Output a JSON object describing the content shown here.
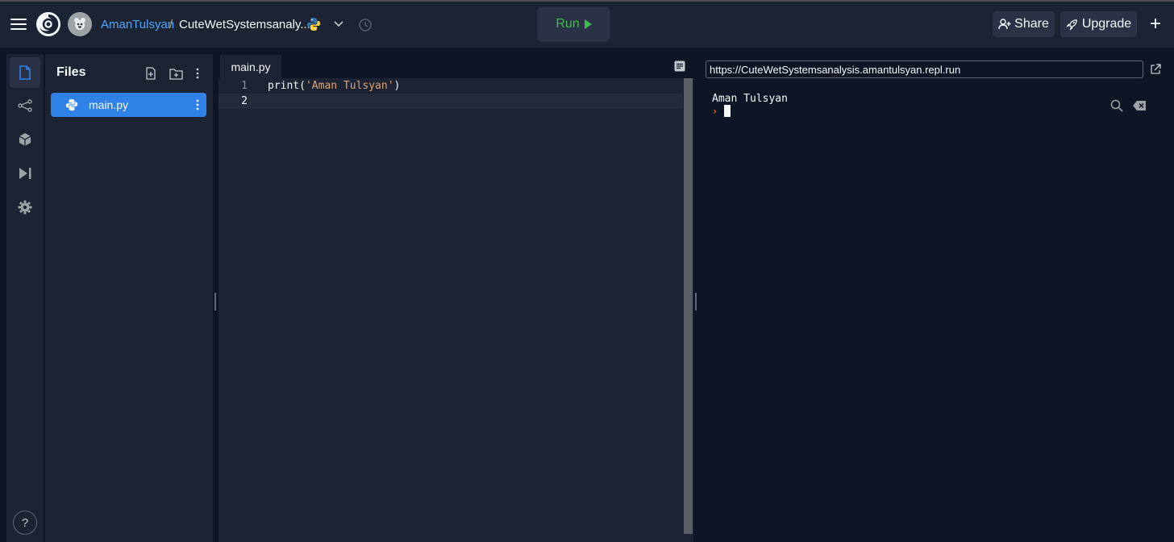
{
  "header": {
    "owner": "AmanTulsyan",
    "separator": "/",
    "repl_name": "CuteWetSystemsanaly...",
    "run_label": "Run",
    "share_label": "Share",
    "upgrade_label": "Upgrade",
    "new_label": "+"
  },
  "sidebar": {
    "icons": [
      "files-icon",
      "version-control-icon",
      "packages-icon",
      "debugger-icon",
      "settings-icon"
    ],
    "help_label": "?"
  },
  "files": {
    "title": "Files",
    "items": [
      {
        "name": "main.py",
        "icon": "python-icon",
        "selected": true
      }
    ]
  },
  "editor": {
    "tab_label": "main.py",
    "lines": [
      {
        "number": "1",
        "code_prefix": "print(",
        "code_string": "'Aman Tulsyan'",
        "code_suffix": ")"
      },
      {
        "number": "2",
        "code_prefix": "",
        "code_string": "",
        "code_suffix": ""
      }
    ],
    "active_line": 2
  },
  "console": {
    "url": "https://CuteWetSystemsanalysis.amantulsyan.repl.run",
    "output": "Aman Tulsyan",
    "prompt": "›"
  },
  "colors": {
    "accent": "#3081e8",
    "owner_link": "#4ea6ff",
    "run_green": "#3fb950",
    "prompt_orange": "#f26522",
    "string": "#dba476"
  }
}
